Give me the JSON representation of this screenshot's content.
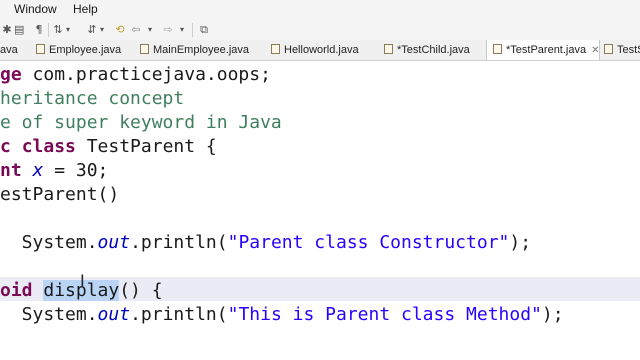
{
  "menubar": {
    "items": [
      "Window",
      "Help"
    ]
  },
  "toolbar": {
    "icons": [
      "debug-icon",
      "run-icon",
      "paragraph-icon",
      "sort-icon",
      "dropdown-arrow-icon",
      "coverage-icon",
      "dropdown-arrow-icon",
      "back-icon",
      "prev-edit-icon",
      "dropdown-arrow-icon",
      "forward-icon",
      "dropdown-arrow-icon",
      "pin-editor-icon"
    ]
  },
  "tabs": [
    {
      "label": "ava",
      "active": false
    },
    {
      "label": "Employee.java",
      "active": false
    },
    {
      "label": "MainEmployee.java",
      "active": false
    },
    {
      "label": "Helloworld.java",
      "active": false
    },
    {
      "label": "*TestChild.java",
      "active": false
    },
    {
      "label": "*TestParent.java",
      "active": true,
      "close": "✕"
    },
    {
      "label": "TestS",
      "active": false
    }
  ],
  "code": {
    "l1": {
      "a": "ge ",
      "b": "com.practicejava.oops;"
    },
    "l2": {
      "a": "heritance concept"
    },
    "l3": {
      "a": "e of super keyword in Java"
    },
    "l4": {
      "a": "c ",
      "b": "class",
      "c": " TestParent {"
    },
    "l5": {
      "a": "nt",
      "b": " ",
      "c": "x",
      "d": " = 30;"
    },
    "l6": {
      "a": "estParent()"
    },
    "l8": {
      "a": "  System.",
      "b": "out",
      "c": ".println(",
      "d": "\"Parent class Constructor\"",
      "e": ");"
    },
    "l10": {
      "a": "oid",
      "b": " ",
      "c": "display",
      "d": "() {"
    },
    "l11": {
      "a": "  System.",
      "b": "out",
      "c": ".println(",
      "d": "\"This is Parent class Method\"",
      "e": ");"
    }
  }
}
